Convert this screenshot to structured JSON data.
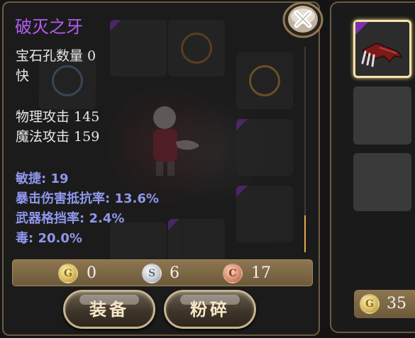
{
  "item": {
    "name": "破灭之牙",
    "gem_slots": "宝石孔数量 0",
    "speed": "快",
    "physical_attack": "物理攻击 145",
    "magic_attack": "魔法攻击 159"
  },
  "bonuses": [
    "敏捷: 19",
    "暴击伤害抵抗率: 13.6%",
    "武器格挡率: 2.4%",
    "毒: 20.0%"
  ],
  "price": {
    "gold": "0",
    "silver": "6",
    "copper": "17"
  },
  "coin_letters": {
    "gold": "G",
    "silver": "S",
    "copper": "C"
  },
  "buttons": {
    "equip": "装备",
    "smash": "粉碎"
  },
  "side": {
    "gold_amount": "35"
  },
  "icons": {
    "close": "close-x-icon",
    "gold": "gold-coin-icon",
    "silver": "silver-coin-icon",
    "copper": "copper-coin-icon",
    "weapon": "claw-weapon-icon"
  },
  "colors": {
    "item_name": "#b25cf0",
    "bonus_stat": "#8f97ec",
    "stat_text": "#e8e8e8"
  }
}
